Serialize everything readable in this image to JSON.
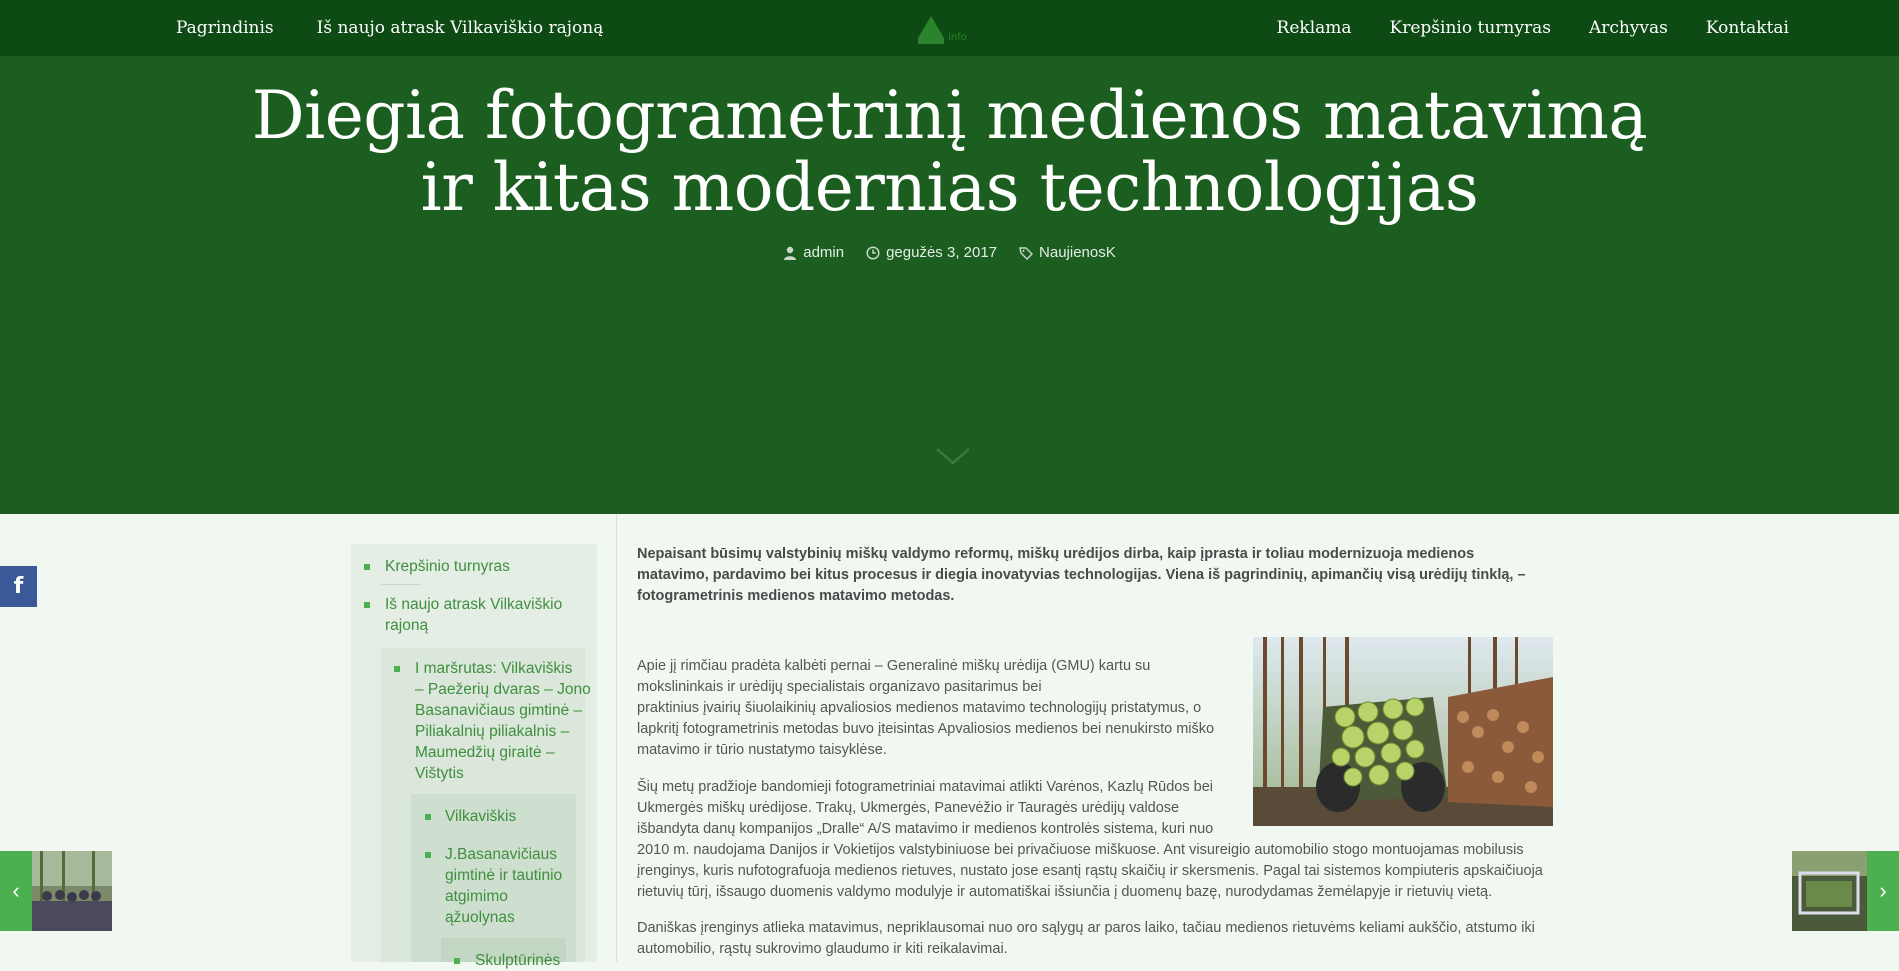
{
  "nav": {
    "left": [
      "Pagrindinis",
      "Iš naujo atrask Vilkaviškio rajoną"
    ],
    "right": [
      "Reklama",
      "Krepšinio turnyras",
      "Archyvas",
      "Kontaktai"
    ],
    "logo_text": "info"
  },
  "article": {
    "title_line1": "Diegia fotogrametrinį medienos matavimą",
    "title_line2": "ir kitas modernias technologijas",
    "author": "admin",
    "date": "gegužės 3, 2017",
    "category": "NaujienosK",
    "intro": "Nepaisant būsimų valstybinių miškų valdymo reformų, miškų urėdijos dirba, kaip įprasta ir toliau modernizuoja medienos matavimo, pardavimo bei kitus procesus ir diegia inovatyvias technologijas. Viena iš pagrindinių, apimančių visą urėdijų tinklą, – fotogrametrinis medienos matavimo metodas.",
    "p1_lines": [
      "Apie jį rimčiau pradėta kalbėti pernai – Generalinė miškų urėdija (GMU) kartu su",
      "mokslininkais ir urėdijų specialistais organizavo pasitarimus bei",
      "praktinius įvairių šiuolaikinių apvaliosios medienos matavimo technologijų pristatymus, o",
      "lapkritį fotogrametrinis metodas buvo įteisintas Apvaliosios medienos bei nenukirsto miško",
      "matavimo ir tūrio nustatymo taisyklėse."
    ],
    "p2_lines": [
      "Šių metų pradžioje bandomieji fotogrametriniai matavimai atlikti Varėnos, Kazlų Rūdos  bei",
      "Ukmergės miškų urėdijose. Trakų, Ukmergės, Panevėžio ir Tauragės urėdijų valdose",
      "išbandyta danų kompanijos „Dralle“ A/S matavimo ir medienos kontrolės sistema, kuri nuo",
      "2010 m. naudojama Danijos ir Vokietijos valstybiniuose bei privačiuose miškuose. Ant visureigio automobilio stogo montuojamas mobilusis",
      "įrenginys, kuris nufotografuoja medienos rietuves, nustato jose esantį rąstų skaičių ir skersmenis. Pagal tai sistemos kompiuteris apskaičiuoja",
      "rietuvių tūrį, išsaugo duomenis valdymo modulyje ir automatiškai išsiunčia į duomenų bazę, nurodydamas žemėlapyje ir rietuvių vietą."
    ],
    "p3_lines": [
      "Daniškas įrenginys atlieka matavimus, nepriklausomai nuo oro sąlygų ar paros laiko, tačiau medienos rietuvėms keliami aukščio, atstumo iki",
      "automobilio, rąstų sukrovimo glaudumo ir kiti  reikalavimai."
    ]
  },
  "sidebar": {
    "item1": "Krepšinio turnyras",
    "item2_line1": "Iš naujo atrask Vilkaviškio",
    "item2_line2": "rajoną",
    "sub1_lines": [
      "I maršrutas: Vilkaviškis",
      "– Paežerių dvaras – Jono",
      "Basanavičiaus gimtinė –",
      "Piliakalnių piliakalnis –",
      "Maumedžių giraitė –",
      "Vištytis"
    ],
    "sub2a": "Vilkaviškis",
    "sub2b_lines": [
      "J.Basanavičiaus",
      "gimtinė ir tautinio",
      "atgimimo",
      "ąžuolynas"
    ],
    "sub3": "Skulptūrinės"
  },
  "share": {
    "facebook": "f"
  },
  "colors": {
    "topbar": "#0d4a14",
    "hero": "#1b5e20",
    "accent": "#4caf50",
    "link": "#3f8f3f",
    "bg": "#f1f8f1"
  }
}
